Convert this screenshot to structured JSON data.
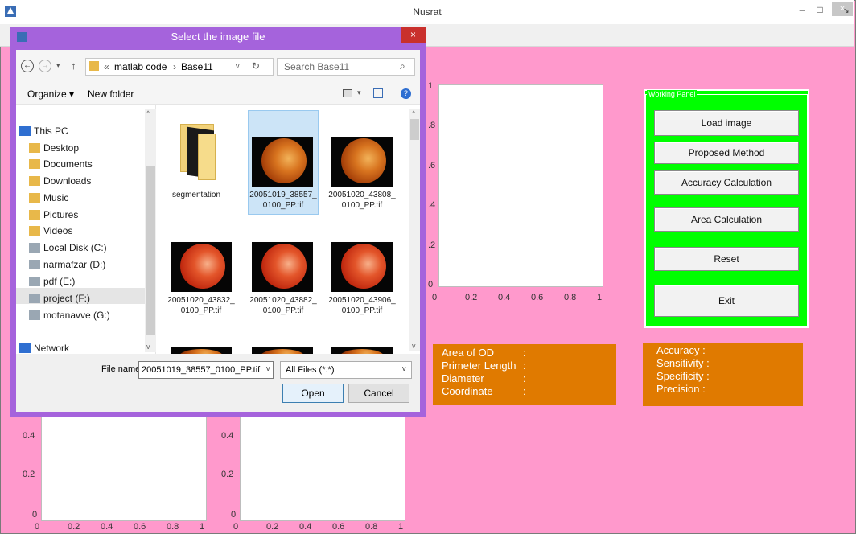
{
  "main_window": {
    "title": "Nusrat",
    "minimize_glyph": "–",
    "maximize_glyph": "□",
    "close_glyph": "×",
    "menubar_arrow": "↘"
  },
  "top_axes": {
    "y_ticks": [
      "1",
      ".8",
      ".6",
      ".4",
      ".2",
      "0"
    ],
    "x_ticks": [
      "0",
      "0.2",
      "0.4",
      "0.6",
      "0.8",
      "1"
    ]
  },
  "bottom_axes_left": {
    "y_ticks": [
      "0.4",
      "0.2",
      "0"
    ],
    "x_ticks": [
      "0",
      "0.2",
      "0.4",
      "0.6",
      "0.8",
      "1"
    ]
  },
  "bottom_axes_right": {
    "y_ticks": [
      "0.4",
      "0.2",
      "0"
    ],
    "x_ticks": [
      "0",
      "0.2",
      "0.4",
      "0.6",
      "0.8",
      "1"
    ]
  },
  "working_panel": {
    "title": "Working Panel",
    "buttons": [
      "Load image",
      "Proposed Method",
      "Accuracy Calculation",
      "Area Calculation",
      "Reset",
      "Exit"
    ]
  },
  "od_panel": {
    "lines": [
      {
        "label": "Area  of OD",
        "sep": ":"
      },
      {
        "label": "Primeter Length",
        "sep": ":"
      },
      {
        "label": "Diameter",
        "sep": ":"
      },
      {
        "label": "Coordinate",
        "sep": ":"
      }
    ]
  },
  "metrics_panel": {
    "lines": [
      "Accuracy :",
      "Sensitivity :",
      "Specificity :",
      "Precision  :"
    ]
  },
  "dialog": {
    "title": "Select the image file",
    "close_glyph": "×",
    "address": {
      "prefix": "«",
      "part1": "matlab code",
      "sep": "›",
      "part2": "Base11"
    },
    "search_placeholder": "Search Base11",
    "organize_label": "Organize ▾",
    "new_folder_label": "New folder",
    "nav_items": [
      {
        "label": "This PC",
        "icon": "computer-icon"
      },
      {
        "label": "Desktop",
        "icon": "folder-icon"
      },
      {
        "label": "Documents",
        "icon": "folder-icon"
      },
      {
        "label": "Downloads",
        "icon": "folder-icon"
      },
      {
        "label": "Music",
        "icon": "folder-icon"
      },
      {
        "label": "Pictures",
        "icon": "folder-icon"
      },
      {
        "label": "Videos",
        "icon": "folder-icon"
      },
      {
        "label": "Local Disk (C:)",
        "icon": "drive-icon"
      },
      {
        "label": "narmafzar (D:)",
        "icon": "drive-icon"
      },
      {
        "label": "pdf (E:)",
        "icon": "drive-icon"
      },
      {
        "label": "project (F:)",
        "icon": "drive-icon"
      },
      {
        "label": "motanavve (G:)",
        "icon": "drive-icon"
      },
      {
        "label": "Network",
        "icon": "network-icon"
      }
    ],
    "files": [
      {
        "name1": "segmentation",
        "name2": "",
        "kind": "folder"
      },
      {
        "name1": "20051019_38557_",
        "name2": "0100_PP.tif",
        "kind": "image",
        "selected": true
      },
      {
        "name1": "20051020_43808_",
        "name2": "0100_PP.tif",
        "kind": "image"
      },
      {
        "name1": "20051020_43832_",
        "name2": "0100_PP.tif",
        "kind": "image"
      },
      {
        "name1": "20051020_43882_",
        "name2": "0100_PP.tif",
        "kind": "image"
      },
      {
        "name1": "20051020_43906_",
        "name2": "0100_PP.tif",
        "kind": "image"
      }
    ],
    "file_name_label": "File name:",
    "file_name_value": "20051019_38557_0100_PP.tif",
    "file_type_value": "All Files (*.*)",
    "open_label": "Open",
    "cancel_label": "Cancel"
  },
  "colors": {
    "background": "#ff99cc",
    "panel_green": "#00ff00",
    "panel_orange": "#e07a00",
    "dialog_frame": "#a563dc"
  }
}
